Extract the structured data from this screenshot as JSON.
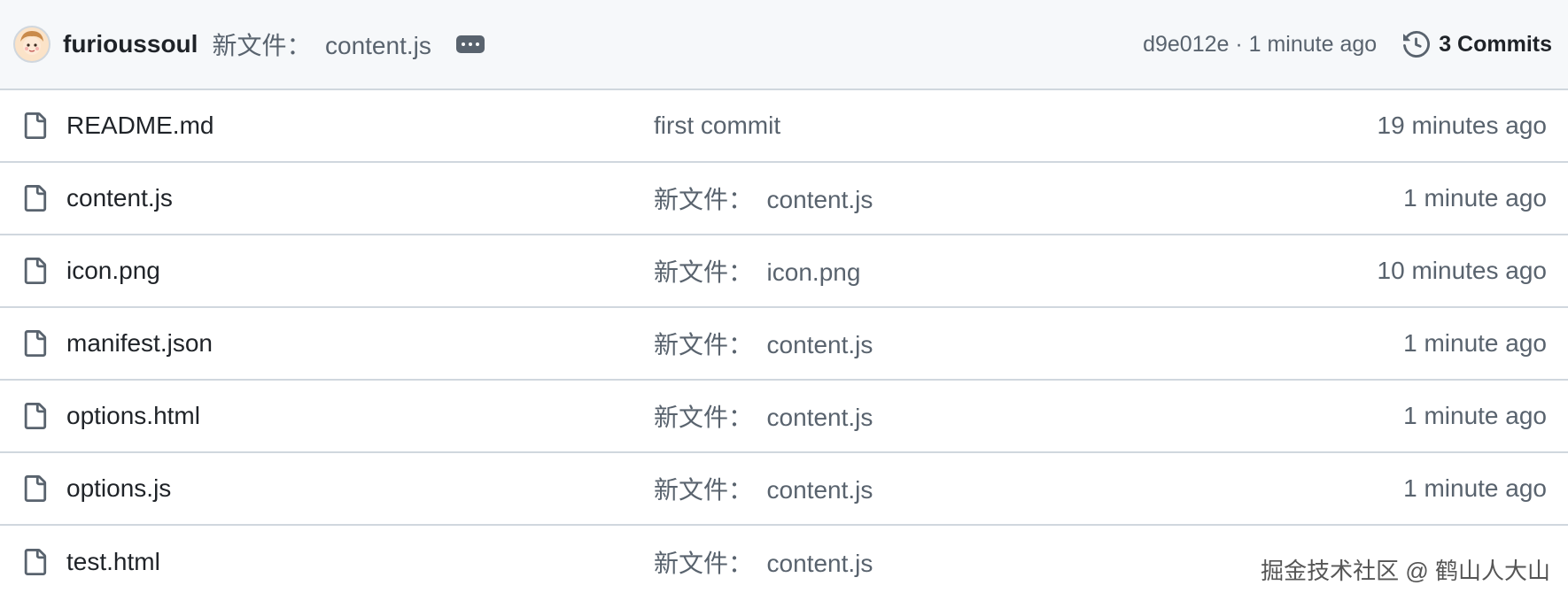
{
  "commit_bar": {
    "author": "furioussoul",
    "message": "新文件：  content.js",
    "sha_and_time": "d9e012e · 1 minute ago",
    "commits_label": "3 Commits",
    "icons": {
      "avatar": "avatar-image",
      "ellipsis": "ellipsis-icon",
      "history": "history-clock-icon"
    }
  },
  "files": [
    {
      "name": "README.md",
      "commit_message": "first commit",
      "age": "19 minutes ago",
      "icon": "file-icon"
    },
    {
      "name": "content.js",
      "commit_message": "新文件：  content.js",
      "age": "1 minute ago",
      "icon": "file-icon"
    },
    {
      "name": "icon.png",
      "commit_message": "新文件：  icon.png",
      "age": "10 minutes ago",
      "icon": "file-icon"
    },
    {
      "name": "manifest.json",
      "commit_message": "新文件：  content.js",
      "age": "1 minute ago",
      "icon": "file-icon"
    },
    {
      "name": "options.html",
      "commit_message": "新文件：  content.js",
      "age": "1 minute ago",
      "icon": "file-icon"
    },
    {
      "name": "options.js",
      "commit_message": "新文件：  content.js",
      "age": "1 minute ago",
      "icon": "file-icon"
    },
    {
      "name": "test.html",
      "commit_message": "新文件：  content.js",
      "age": "",
      "icon": "file-icon"
    }
  ],
  "watermark": "掘金技术社区 @ 鹤山人大山",
  "colors": {
    "header_bg": "#f6f8fa",
    "border": "#d0d7de",
    "text_primary": "#1f2328",
    "text_muted": "#59636e"
  }
}
